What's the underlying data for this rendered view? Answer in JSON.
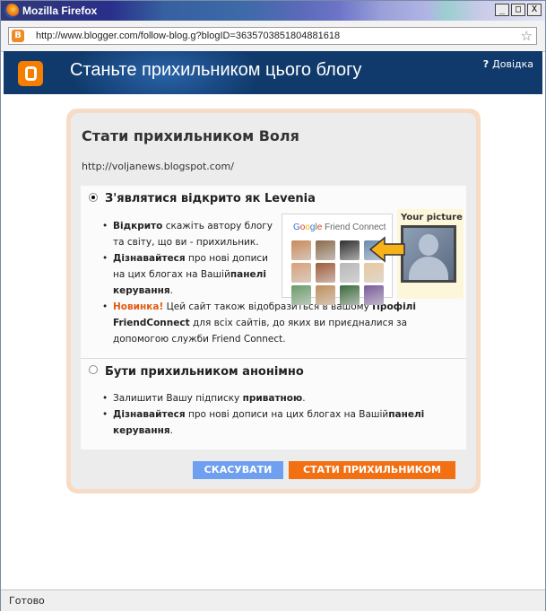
{
  "window": {
    "title": "Mozilla Firefox",
    "controls": {
      "minimize": "_",
      "maximize": "□",
      "close": "X"
    }
  },
  "urlbar": {
    "url": "http://www.blogger.com/follow-blog.g?blogID=3635703851804881618",
    "site_icon": "B"
  },
  "header": {
    "title": "Станьте прихильником цього блогу",
    "help_icon": "?",
    "help_label": "Довідка"
  },
  "dialog": {
    "title": "Стати прихильником Воля",
    "blog_url": "http://voljanews.blogspot.com/",
    "option_public": {
      "label": "З'являтися відкрито як Levenia",
      "selected": true,
      "bullets": [
        {
          "b": "Відкрито",
          "t": " скажіть автору блогу та світу, що ви - прихильник."
        },
        {
          "b": "Дізнавайтеся",
          "t": " про нові дописи на цих блогах на Вашій",
          "b2": "панелі керування",
          "t2": "."
        },
        {
          "new": "Новинка!",
          "t": " Цей сайт також відобразиться в вашому ",
          "b": "Профілі FriendConnect",
          "t2": " для всіх сайтів, до яких ви приєдналися за допомогою служби Friend Connect."
        }
      ],
      "friend_connect_logo": {
        "g": "G",
        "o1": "o",
        "o2": "o",
        "g2": "g",
        "l": "l",
        "e": "e",
        "suffix": " Friend Connect"
      },
      "your_picture_label": "Your picture"
    },
    "option_anon": {
      "label": "Бути прихильником анонімно",
      "selected": false,
      "bullets": [
        {
          "t": "Залишити Вашу підписку ",
          "b": "приватною",
          "t2": "."
        },
        {
          "b": "Дізнавайтеся",
          "t": " про нові дописи на цих блогах на Вашій",
          "b2": "панелі керування",
          "t2": "."
        }
      ]
    },
    "buttons": {
      "cancel": "СКАСУВАТИ",
      "follow": "СТАТИ ПРИХИЛЬНИКОМ"
    }
  },
  "status": {
    "text": "Готово"
  },
  "colors": {
    "header_bg": "#103a6b",
    "brand_orange": "#f57d00",
    "cancel_btn": "#6e9ff0",
    "follow_btn": "#f26f12",
    "new_label": "#e25b12"
  },
  "avatars": [
    "#c98a5a",
    "#8a6a4a",
    "#2e2e2e",
    "#6a8ab0",
    "#d7a07a",
    "#a05a3a",
    "#b8b8b8",
    "#e8c8a0",
    "#6a9a6a",
    "#c0905a",
    "#3a6a3a",
    "#7a5a9a"
  ]
}
